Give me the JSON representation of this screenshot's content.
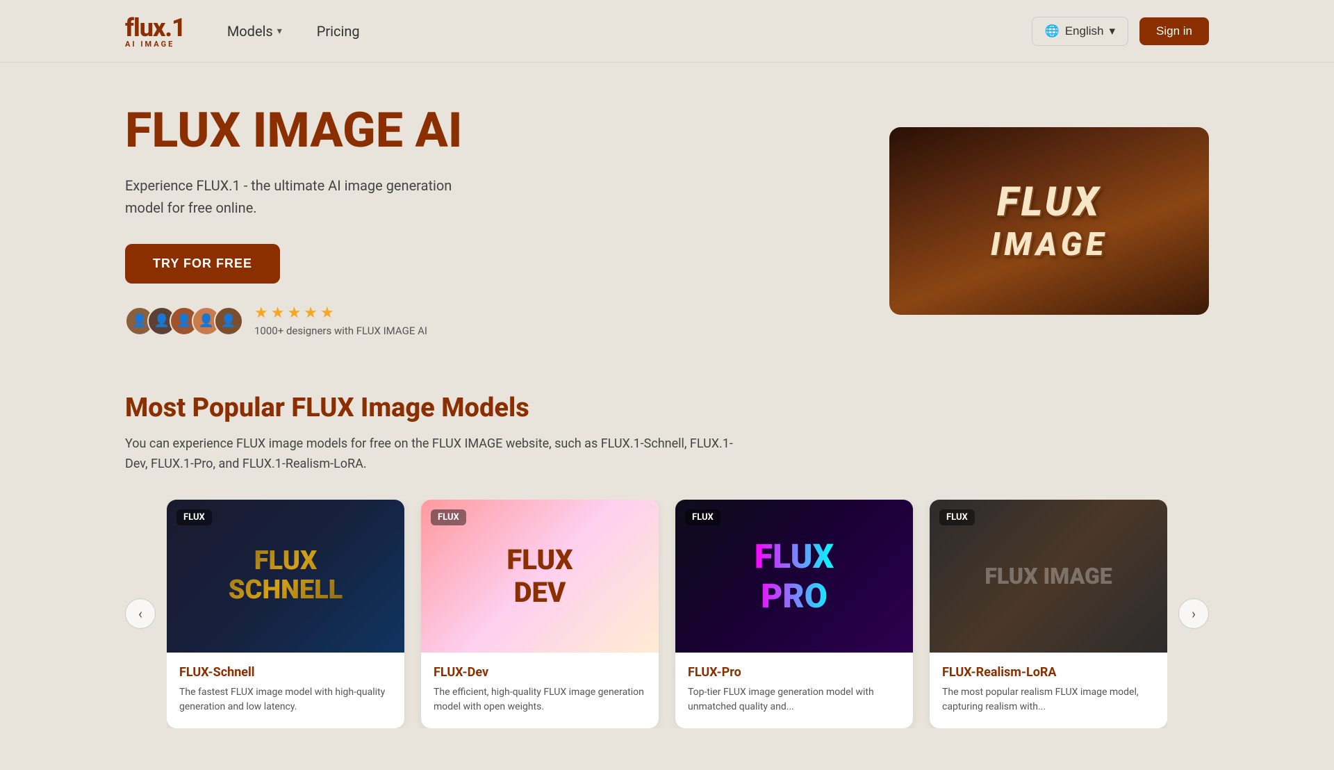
{
  "brand": {
    "name": "flux.1",
    "sub": "AI IMAGE"
  },
  "nav": {
    "models_label": "Models",
    "pricing_label": "Pricing",
    "language": "English",
    "signin": "Sign in"
  },
  "hero": {
    "title": "FLUX IMAGE AI",
    "subtitle": "Experience FLUX.1 - the ultimate AI image generation model for free online.",
    "cta": "TRY FOR FREE",
    "proof_text": "1000+ designers with FLUX IMAGE AI",
    "stars": 5
  },
  "models_section": {
    "title": "Most Popular FLUX Image Models",
    "description": "You can experience FLUX image models for free on the FLUX IMAGE website, such as FLUX.1-Schnell, FLUX.1-Dev, FLUX.1-Pro, and FLUX.1-Realism-LoRA.",
    "models": [
      {
        "badge": "FLUX",
        "name": "FLUX-Schnell",
        "desc": "The fastest FLUX image model with high-quality generation and low latency.",
        "img_type": "schnell",
        "img_label": "FLUX\nSCHNELL"
      },
      {
        "badge": "FLUX",
        "name": "FLUX-Dev",
        "desc": "The efficient, high-quality FLUX image generation model with open weights.",
        "img_type": "dev",
        "img_label": "FLUX\nDEV"
      },
      {
        "badge": "FLUX",
        "name": "FLUX-Pro",
        "desc": "Top-tier FLUX image generation model with unmatched quality and...",
        "img_type": "pro",
        "img_label": "FLUX\nPRO"
      },
      {
        "badge": "FLUX",
        "name": "FLUX-Realism-LoRA",
        "desc": "The most popular realism FLUX image model, capturing realism with...",
        "img_type": "realism",
        "img_label": "FLUX\nIMAGE"
      }
    ],
    "arrow_left": "‹",
    "arrow_right": "›"
  }
}
